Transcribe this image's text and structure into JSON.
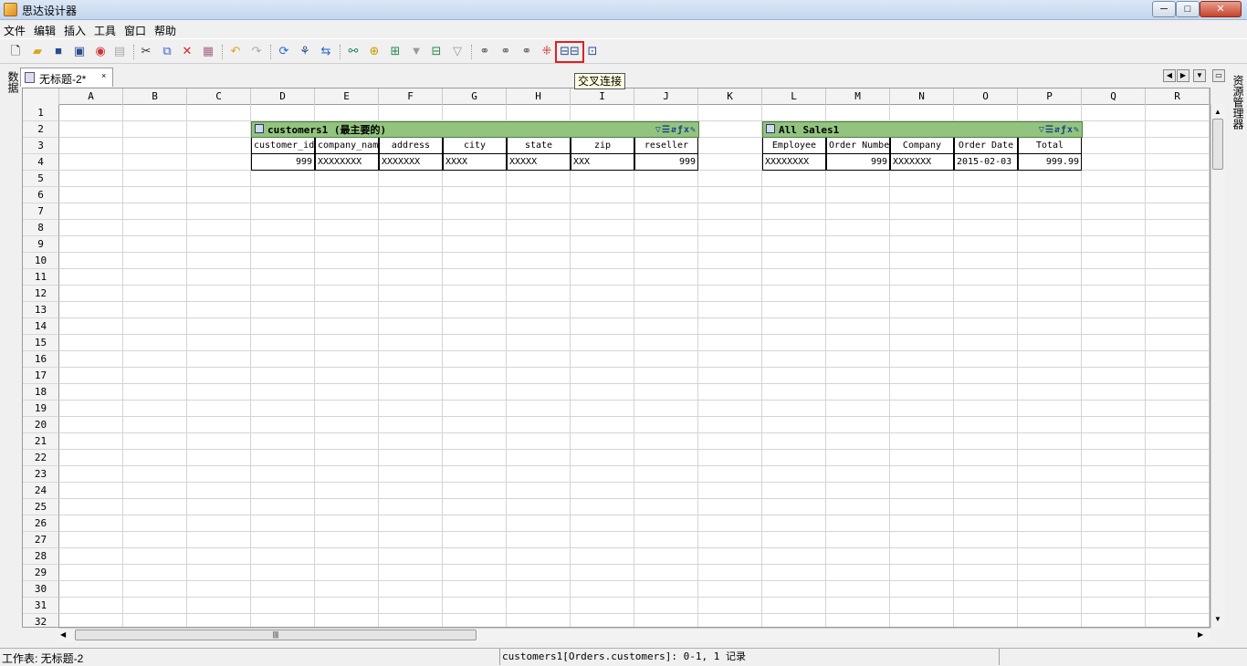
{
  "window": {
    "title": "思达设计器",
    "min": "─",
    "max": "□",
    "close": "✕"
  },
  "menu": [
    "文件",
    "编辑",
    "插入",
    "工具",
    "窗口",
    "帮助"
  ],
  "toolbar": {
    "icons": [
      "new-file-icon",
      "open-folder-icon",
      "save-icon",
      "save-all-icon",
      "preview-icon",
      "disabled-icon",
      "cut-icon",
      "copy-icon",
      "delete-icon",
      "paste-icon",
      "undo-icon",
      "redo-icon",
      "refresh-icon",
      "tree-icon",
      "sync-icon",
      "join-icon",
      "add-datasource-icon",
      "add-table-icon",
      "filter-icon",
      "table-config-icon",
      "filter-config-icon",
      "inner-join-icon",
      "left-join-icon",
      "right-join-icon",
      "merge-icon",
      "cross-join-icon",
      "full-join-icon"
    ],
    "tooltip": "交叉连接"
  },
  "side": {
    "left": "数据",
    "right": "资源管理器"
  },
  "tab": {
    "title": "无标题-2*",
    "close": "×"
  },
  "columns": [
    "A",
    "B",
    "C",
    "D",
    "E",
    "F",
    "G",
    "H",
    "I",
    "J",
    "K",
    "L",
    "M",
    "N",
    "O",
    "P",
    "Q",
    "R"
  ],
  "rows": [
    "1",
    "2",
    "3",
    "4",
    "5",
    "6",
    "7",
    "8",
    "9",
    "10",
    "11",
    "12",
    "13",
    "14",
    "15",
    "16",
    "17",
    "18",
    "19",
    "20",
    "21",
    "22",
    "23",
    "24",
    "25",
    "26",
    "27",
    "28",
    "29",
    "30",
    "31",
    "32"
  ],
  "tables": {
    "customers": {
      "title": "customers1 (最主要的)",
      "tools": "▽☰⇵ƒx✎",
      "headers": [
        "customer_id",
        "company_name",
        "address",
        "city",
        "state",
        "zip",
        "reseller"
      ],
      "values": [
        "999",
        "XXXXXXXX",
        "XXXXXXX",
        "XXXX",
        "XXXXX",
        "XXX",
        "999"
      ]
    },
    "sales": {
      "title": "All Sales1",
      "tools": "▽☰⇵ƒx✎",
      "headers": [
        "Employee",
        "Order Number",
        "Company",
        "Order Date",
        "Total"
      ],
      "values": [
        "XXXXXXXX",
        "999",
        "XXXXXXX",
        "2015-02-03",
        "999.99"
      ]
    }
  },
  "status": {
    "left": "工作表: 无标题-2",
    "middle": "customers1[Orders.customers]: 0-1, 1 记录"
  }
}
